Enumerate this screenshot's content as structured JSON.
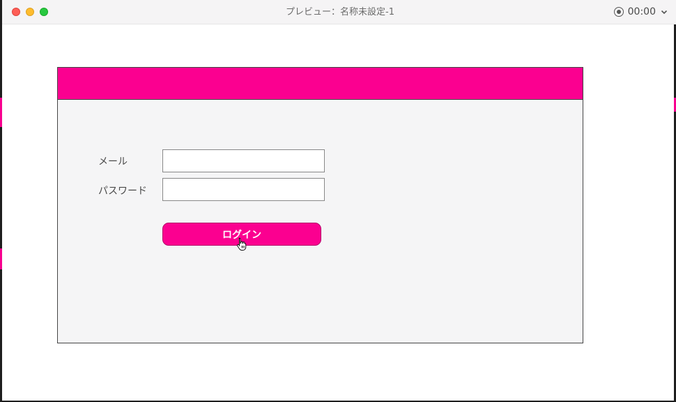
{
  "window": {
    "title": "プレビュー：名称未設定-1",
    "timer": "00:00"
  },
  "form": {
    "email_label": "メール",
    "email_value": "",
    "password_label": "パスワード",
    "password_value": "",
    "login_label": "ログイン"
  },
  "colors": {
    "accent": "#fb0090",
    "panel_bg": "#f5f5f6"
  },
  "icons": {
    "record": "record-icon",
    "dropdown": "chevron-down-icon",
    "cursor": "pointer-hand-icon"
  }
}
